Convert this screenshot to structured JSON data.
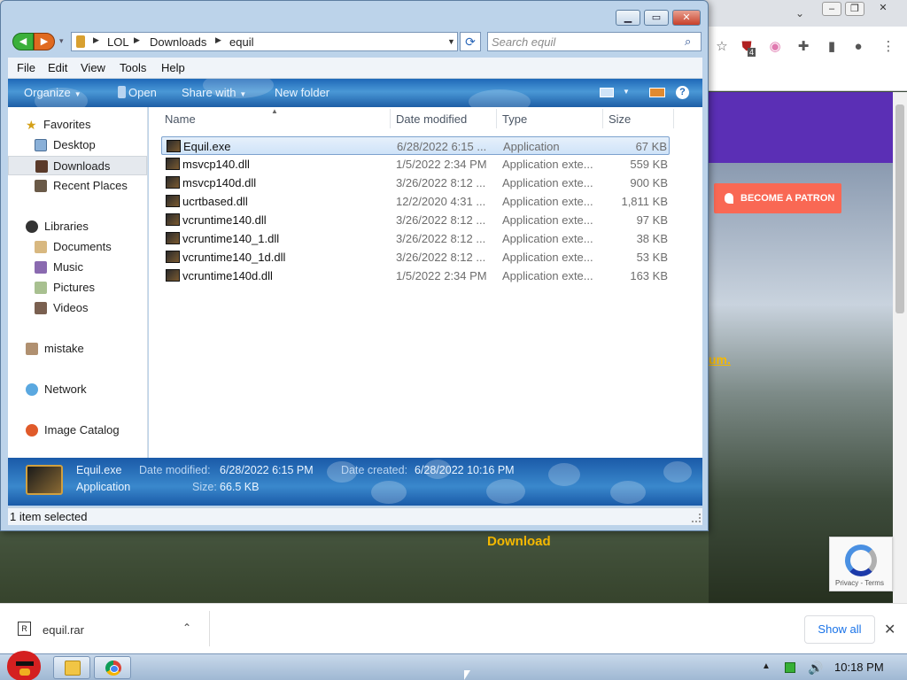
{
  "explorer": {
    "breadcrumbs": [
      "LOL",
      "Downloads",
      "equil"
    ],
    "search_placeholder": "Search equil",
    "menu": [
      "File",
      "Edit",
      "View",
      "Tools",
      "Help"
    ],
    "commands": {
      "organize": "Organize",
      "open": "Open",
      "share_with": "Share with",
      "new_folder": "New folder"
    },
    "nav": {
      "favorites": "Favorites",
      "desktop": "Desktop",
      "downloads": "Downloads",
      "recent_places": "Recent Places",
      "libraries": "Libraries",
      "documents": "Documents",
      "music": "Music",
      "pictures": "Pictures",
      "videos": "Videos",
      "mistake": "mistake",
      "network": "Network",
      "image_catalog": "Image Catalog"
    },
    "columns": {
      "name": "Name",
      "date_modified": "Date modified",
      "type": "Type",
      "size": "Size"
    },
    "files": [
      {
        "name": "Equil.exe",
        "date": "6/28/2022 6:15 ...",
        "type": "Application",
        "size": "67 KB"
      },
      {
        "name": "msvcp140.dll",
        "date": "1/5/2022 2:34 PM",
        "type": "Application exte...",
        "size": "559 KB"
      },
      {
        "name": "msvcp140d.dll",
        "date": "3/26/2022 8:12 ...",
        "type": "Application exte...",
        "size": "900 KB"
      },
      {
        "name": "ucrtbased.dll",
        "date": "12/2/2020 4:31 ...",
        "type": "Application exte...",
        "size": "1,811 KB"
      },
      {
        "name": "vcruntime140.dll",
        "date": "3/26/2022 8:12 ...",
        "type": "Application exte...",
        "size": "97 KB"
      },
      {
        "name": "vcruntime140_1.dll",
        "date": "3/26/2022 8:12 ...",
        "type": "Application exte...",
        "size": "38 KB"
      },
      {
        "name": "vcruntime140_1d.dll",
        "date": "3/26/2022 8:12 ...",
        "type": "Application exte...",
        "size": "53 KB"
      },
      {
        "name": "vcruntime140d.dll",
        "date": "1/5/2022 2:34 PM",
        "type": "Application exte...",
        "size": "163 KB"
      }
    ],
    "details": {
      "name": "Equil.exe",
      "type": "Application",
      "date_modified_label": "Date modified:",
      "date_modified": "6/28/2022 6:15 PM",
      "size_label": "Size:",
      "size": "66.5 KB",
      "date_created_label": "Date created:",
      "date_created": "6/28/2022 10:16 PM"
    },
    "status": "1 item selected"
  },
  "browser": {
    "patron_button": "BECOME A PATRON",
    "link_fragment": "um.",
    "download_link": "Download",
    "recaptcha": "Privacy - Terms",
    "extension_badge": "4",
    "download_file": "equil.rar",
    "show_all": "Show all"
  },
  "taskbar": {
    "clock": "10:18 PM"
  },
  "colors": {
    "patron_red": "#f96854",
    "download_gold": "#f5b800",
    "page_header_purple": "#5b2fb5",
    "chrome_link_blue": "#1a73e8"
  },
  "icons": [
    "search-icon",
    "refresh-icon",
    "help-icon",
    "star-icon",
    "folder-icon",
    "chrome-icon",
    "close-icon",
    "chevron-down-icon",
    "puzzle-icon",
    "profile-icon",
    "kebab-menu-icon"
  ]
}
